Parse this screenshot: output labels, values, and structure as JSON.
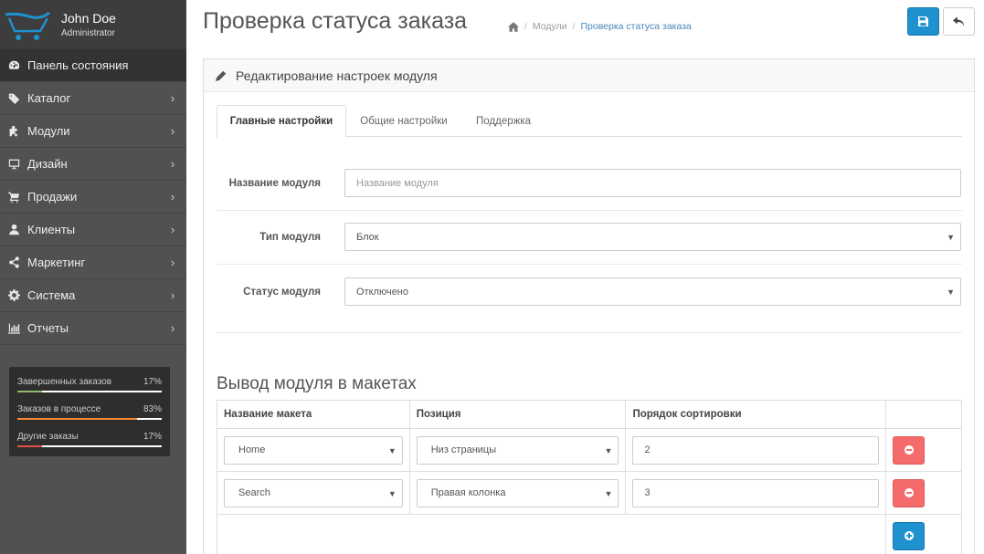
{
  "sidebar": {
    "profile": {
      "name": "John Doe",
      "role": "Administrator"
    },
    "menu": [
      {
        "label": "Панель состояния",
        "icon": "dashboard-icon",
        "active": true
      },
      {
        "label": "Каталог",
        "icon": "tag-icon"
      },
      {
        "label": "Модули",
        "icon": "puzzle-icon"
      },
      {
        "label": "Дизайн",
        "icon": "desktop-icon"
      },
      {
        "label": "Продажи",
        "icon": "cart-icon"
      },
      {
        "label": "Клиенты",
        "icon": "user-icon"
      },
      {
        "label": "Маркетинг",
        "icon": "share-icon"
      },
      {
        "label": "Система",
        "icon": "cog-icon"
      },
      {
        "label": "Отчеты",
        "icon": "bar-chart-icon"
      }
    ],
    "stats": [
      {
        "label": "Завершенных заказов",
        "value": "17%",
        "fraction": 0.17,
        "color": "#8fbb6c"
      },
      {
        "label": "Заказов в процессе",
        "value": "83%",
        "fraction": 0.83,
        "color": "#f38733"
      },
      {
        "label": "Другие заказы",
        "value": "17%",
        "fraction": 0.17,
        "color": "#e3503e"
      }
    ]
  },
  "header": {
    "title": "Проверка статуса заказа",
    "breadcrumb": {
      "modules": "Модули",
      "current": "Проверка статуса заказа"
    }
  },
  "panel": {
    "heading": "Редактирование настроек модуля",
    "tabs": [
      "Главные настройки",
      "Общие настройки",
      "Поддержка"
    ],
    "fields": {
      "name": {
        "label": "Название модуля",
        "placeholder": "Название модуля"
      },
      "type": {
        "label": "Тип модуля",
        "value": "Блок"
      },
      "status": {
        "label": "Статус модуля",
        "value": "Отключено"
      }
    }
  },
  "layouts": {
    "title": "Вывод модуля в макетах",
    "headers": {
      "layout": "Название макета",
      "position": "Позиция",
      "sort": "Порядок сортировки"
    },
    "rows": [
      {
        "layout": "Home",
        "position": "Низ страницы",
        "sort": "2"
      },
      {
        "layout": "Search",
        "position": "Правая колонка",
        "sort": "3"
      }
    ]
  },
  "colors": {
    "primary": "#1e91cf",
    "danger": "#f56b6b",
    "sidebar": "#515151",
    "sidebar_header": "#3d3d3d"
  }
}
